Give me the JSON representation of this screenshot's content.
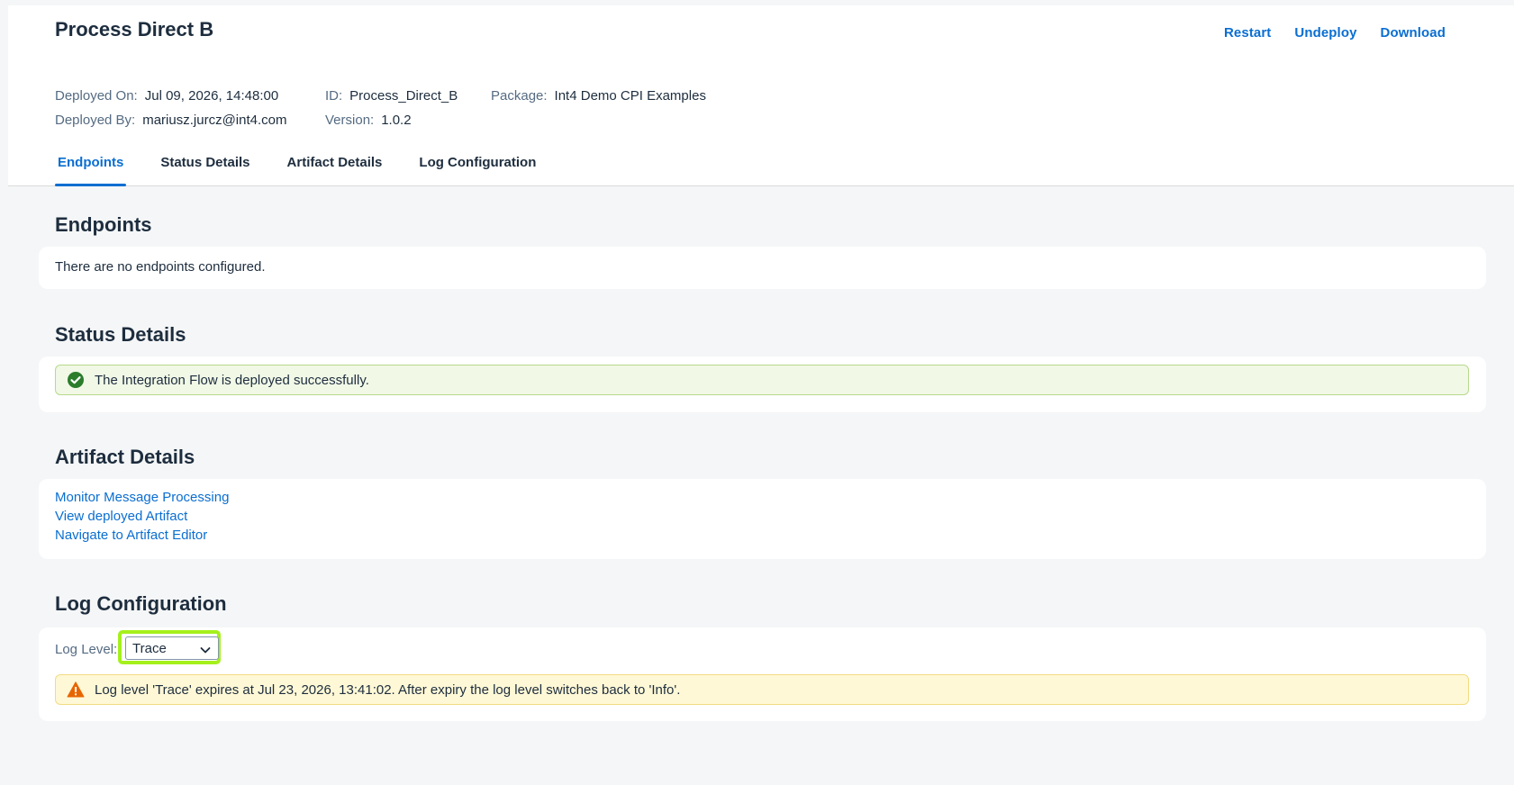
{
  "header": {
    "title": "Process Direct B",
    "actions": {
      "restart": "Restart",
      "undeploy": "Undeploy",
      "download": "Download"
    },
    "meta": {
      "deployed_on_label": "Deployed On:",
      "deployed_on_value": "Jul 09, 2026, 14:48:00",
      "deployed_by_label": "Deployed By:",
      "deployed_by_value": "mariusz.jurcz@int4.com",
      "id_label": "ID:",
      "id_value": "Process_Direct_B",
      "version_label": "Version:",
      "version_value": "1.0.2",
      "package_label": "Package:",
      "package_value": "Int4 Demo CPI Examples"
    },
    "tabs": [
      {
        "label": "Endpoints",
        "active": true
      },
      {
        "label": "Status Details",
        "active": false
      },
      {
        "label": "Artifact Details",
        "active": false
      },
      {
        "label": "Log Configuration",
        "active": false
      }
    ]
  },
  "endpoints": {
    "title": "Endpoints",
    "message": "There are no endpoints configured."
  },
  "status_details": {
    "title": "Status Details",
    "message": "The Integration Flow is deployed successfully.",
    "icon": "success-check-icon"
  },
  "artifact_details": {
    "title": "Artifact Details",
    "links": [
      "Monitor Message Processing",
      "View deployed Artifact",
      "Navigate to Artifact Editor"
    ]
  },
  "log_configuration": {
    "title": "Log Configuration",
    "log_level_label": "Log Level:",
    "log_level_value": "Trace",
    "warning": "Log level 'Trace' expires at Jul 23, 2026, 13:41:02. After expiry the log level switches back to 'Info'.",
    "icon": "warning-triangle-icon"
  },
  "colors": {
    "accent": "#0a6ed1",
    "success": "#2b7c2b",
    "warning": "#e76500",
    "highlight": "#a5f01c"
  }
}
